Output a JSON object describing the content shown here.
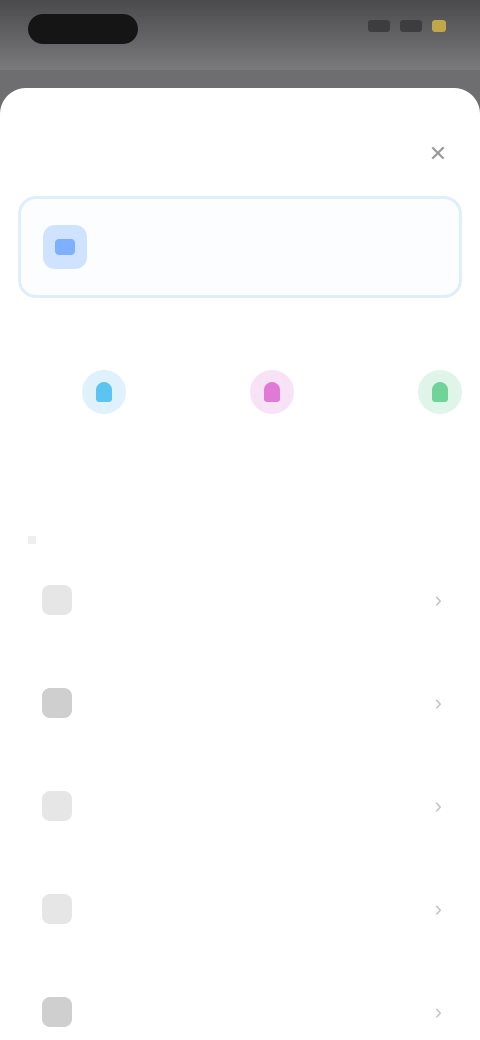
{
  "header": {
    "title": "",
    "close_icon": "close-icon"
  },
  "banner": {
    "icon": "chat-icon",
    "text": ""
  },
  "quick_actions": {
    "section_label": "",
    "items": [
      {
        "label": "",
        "icon": "blue-shield-icon"
      },
      {
        "label": "",
        "icon": "pink-gift-icon"
      },
      {
        "label": "",
        "icon": "green-leaf-icon"
      }
    ]
  },
  "menu": {
    "items": [
      {
        "label": "",
        "icon": "message-icon"
      },
      {
        "label": "",
        "icon": "document-icon"
      },
      {
        "label": "",
        "icon": "info-icon"
      },
      {
        "label": "",
        "icon": "help-icon"
      },
      {
        "label": "",
        "icon": "settings-icon"
      }
    ]
  }
}
